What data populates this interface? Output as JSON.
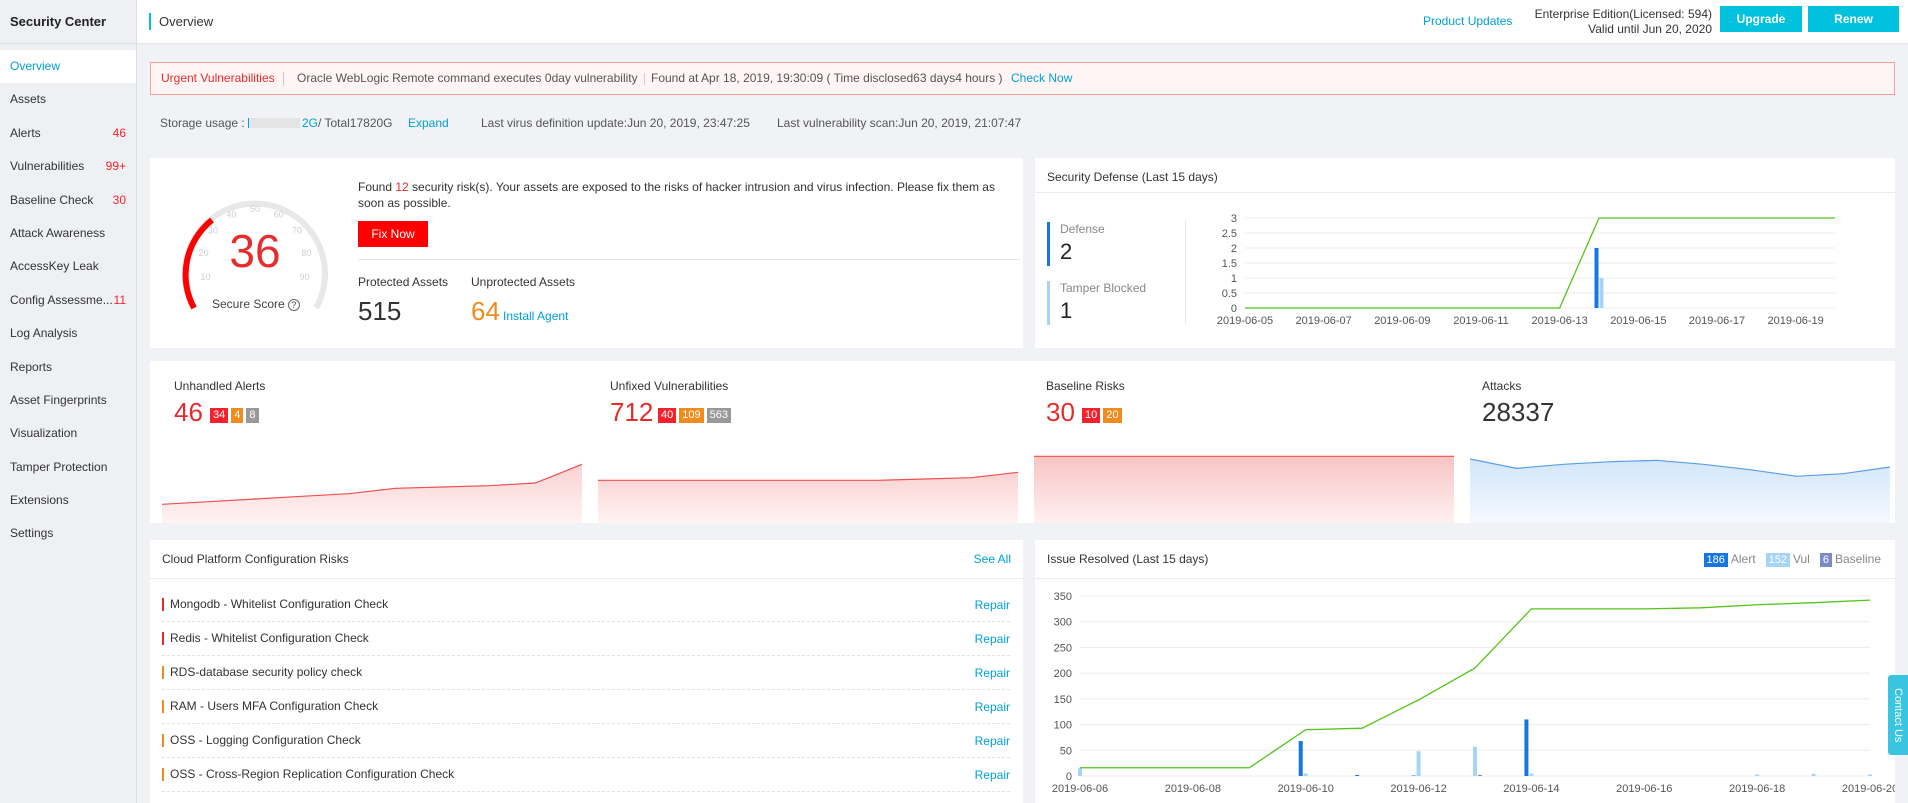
{
  "sidebar": {
    "brand": "Security Center",
    "items": [
      {
        "label": "Overview",
        "count": ""
      },
      {
        "label": "Assets",
        "count": ""
      },
      {
        "label": "Alerts",
        "count": "46"
      },
      {
        "label": "Vulnerabilities",
        "count": "99+"
      },
      {
        "label": "Baseline Check",
        "count": "30"
      },
      {
        "label": "Attack Awareness",
        "count": ""
      },
      {
        "label": "AccessKey Leak",
        "count": ""
      },
      {
        "label": "Config Assessme...",
        "count": "11"
      },
      {
        "label": "Log Analysis",
        "count": ""
      },
      {
        "label": "Reports",
        "count": ""
      },
      {
        "label": "Asset Fingerprints",
        "count": ""
      },
      {
        "label": "Visualization",
        "count": ""
      },
      {
        "label": "Tamper Protection",
        "count": ""
      },
      {
        "label": "Extensions",
        "count": ""
      },
      {
        "label": "Settings",
        "count": ""
      }
    ]
  },
  "header": {
    "title": "Overview",
    "product_updates": "Product Updates",
    "edition_line1": "Enterprise Edition(Licensed: 594)",
    "edition_line2": "Valid until Jun 20, 2020",
    "upgrade": "Upgrade",
    "renew": "Renew"
  },
  "urgent": {
    "tag": "Urgent Vulnerabilities",
    "desc": "Oracle WebLogic Remote command executes 0day vulnerability",
    "found": "Found at Apr 18, 2019, 19:30:09 ( Time disclosed63 days4 hours )",
    "check": "Check Now"
  },
  "storage": {
    "label": "Storage usage :",
    "used": "2G",
    "total": "/ Total17820G",
    "used_fraction": 0.0001,
    "expand": "Expand",
    "virus": "Last virus definition update:Jun 20, 2019, 23:47:25",
    "vulscan": "Last vulnerability scan:Jun 20, 2019, 21:07:47"
  },
  "score": {
    "value": "36",
    "label": "Secure Score",
    "found_prefix": "Found ",
    "risks": "12",
    "found_suffix": " security risk(s). Your assets are exposed to the risks of hacker intrusion and virus infection. Please fix them as soon as possible.",
    "fix_now": "Fix Now",
    "protected_label": "Protected Assets",
    "protected_value": "515",
    "unprotected_label": "Unprotected Assets",
    "unprotected_value": "64",
    "install_agent": "Install Agent",
    "gauge_ticks": [
      "10",
      "20",
      "30",
      "40",
      "50",
      "60",
      "70",
      "80",
      "90"
    ]
  },
  "defense": {
    "title": "Security Defense (Last 15 days)",
    "defense_label": "Defense",
    "defense_value": "2",
    "tamper_label": "Tamper Blocked",
    "tamper_value": "1",
    "colors": {
      "defense": "#1677e0",
      "tamper": "#a6d4f7",
      "line": "#52c41a"
    }
  },
  "metrics": {
    "alerts": {
      "title": "Unhandled Alerts",
      "value": "46",
      "b1": "34",
      "b2": "4",
      "b3": "8"
    },
    "vuls": {
      "title": "Unfixed Vulnerabilities",
      "value": "712",
      "b1": "40",
      "b2": "109",
      "b3": "563"
    },
    "baseline": {
      "title": "Baseline Risks",
      "value": "30",
      "b1": "10",
      "b2": "20"
    },
    "attacks": {
      "title": "Attacks",
      "value": "28337"
    }
  },
  "cloud": {
    "title": "Cloud Platform Configuration Risks",
    "see_all": "See All",
    "rows": [
      {
        "name": "Mongodb - Whitelist Configuration Check",
        "level": "red",
        "action": "Repair"
      },
      {
        "name": "Redis - Whitelist Configuration Check",
        "level": "red",
        "action": "Repair"
      },
      {
        "name": "RDS-database security policy check",
        "level": "orange",
        "action": "Repair"
      },
      {
        "name": "RAM - Users MFA Configuration Check",
        "level": "orange",
        "action": "Repair"
      },
      {
        "name": "OSS - Logging Configuration Check",
        "level": "orange",
        "action": "Repair"
      },
      {
        "name": "OSS - Cross-Region Replication Configuration Check",
        "level": "orange",
        "action": "Repair"
      }
    ]
  },
  "issue": {
    "title": "Issue Resolved (Last 15 days)",
    "legend": [
      {
        "count": "186",
        "label": "Alert",
        "color": "#1677e0"
      },
      {
        "count": "152",
        "label": "Vul",
        "color": "#a6d4f7"
      },
      {
        "count": "6",
        "label": "Baseline",
        "color": "#7b8bc4"
      }
    ]
  },
  "contact": "Contact Us",
  "chart_data": [
    {
      "type": "line",
      "title": "Security Defense (Last 15 days)",
      "x": [
        "2019-06-05",
        "2019-06-06",
        "2019-06-07",
        "2019-06-08",
        "2019-06-09",
        "2019-06-10",
        "2019-06-11",
        "2019-06-12",
        "2019-06-13",
        "2019-06-14",
        "2019-06-15",
        "2019-06-16",
        "2019-06-17",
        "2019-06-18",
        "2019-06-19",
        "2019-06-20"
      ],
      "xticks": [
        "2019-06-05",
        "2019-06-07",
        "2019-06-09",
        "2019-06-11",
        "2019-06-13",
        "2019-06-15",
        "2019-06-17",
        "2019-06-19"
      ],
      "yticks": [
        "0",
        "0.5",
        "1",
        "1.5",
        "2",
        "2.5",
        "3"
      ],
      "ylim": [
        0,
        3
      ],
      "series": [
        {
          "kind": "line",
          "values": [
            0,
            0,
            0,
            0,
            0,
            0,
            0,
            0,
            0,
            3,
            3,
            3,
            3,
            3,
            3,
            3
          ]
        },
        {
          "kind": "bar",
          "values": [
            0,
            0,
            0,
            0,
            0,
            0,
            0,
            0,
            0,
            2,
            0,
            0,
            0,
            0,
            0,
            0
          ]
        },
        {
          "kind": "bar",
          "values": [
            0,
            0,
            0,
            0,
            0,
            0,
            0,
            0,
            0,
            1,
            0,
            0,
            0,
            0,
            0,
            0
          ]
        }
      ]
    },
    {
      "type": "line",
      "title": "Issue Resolved (Last 15 days)",
      "x": [
        "2019-06-06",
        "2019-06-07",
        "2019-06-08",
        "2019-06-09",
        "2019-06-10",
        "2019-06-11",
        "2019-06-12",
        "2019-06-13",
        "2019-06-14",
        "2019-06-15",
        "2019-06-16",
        "2019-06-17",
        "2019-06-18",
        "2019-06-19",
        "2019-06-20"
      ],
      "xticks": [
        "2019-06-06",
        "2019-06-08",
        "2019-06-10",
        "2019-06-12",
        "2019-06-14",
        "2019-06-16",
        "2019-06-18",
        "2019-06-20"
      ],
      "yticks": [
        "0",
        "50",
        "100",
        "150",
        "200",
        "250",
        "300",
        "350"
      ],
      "ylim": [
        0,
        350
      ],
      "series": [
        {
          "kind": "line",
          "values": [
            16,
            16,
            16,
            16,
            90,
            93,
            148,
            210,
            325,
            325,
            325,
            327,
            333,
            337,
            342
          ]
        },
        {
          "kind": "bar",
          "name": "Alert",
          "values": [
            0,
            0,
            0,
            0,
            68,
            2,
            1,
            0,
            110,
            0,
            0,
            0,
            0,
            0,
            0
          ]
        },
        {
          "kind": "bar",
          "name": "Vul",
          "values": [
            15,
            0,
            0,
            0,
            5,
            0,
            48,
            57,
            5,
            0,
            0,
            0,
            3,
            4,
            3
          ]
        },
        {
          "kind": "bar",
          "name": "Baseline",
          "values": [
            0,
            0,
            0,
            0,
            0,
            0,
            0,
            2,
            0,
            0,
            0,
            0,
            0,
            0,
            0
          ]
        }
      ]
    }
  ],
  "metric_trends": {
    "alerts": [
      14,
      16,
      18,
      20,
      22,
      26,
      27,
      28,
      30,
      44
    ],
    "vuls": [
      4,
      4,
      4,
      4,
      4,
      4,
      4,
      5,
      6,
      10
    ],
    "baseline": [
      10,
      10,
      10,
      10,
      10,
      10,
      10,
      10,
      10,
      10
    ],
    "attacks": [
      48,
      41,
      44,
      46,
      47,
      44,
      40,
      35,
      37,
      42
    ]
  }
}
